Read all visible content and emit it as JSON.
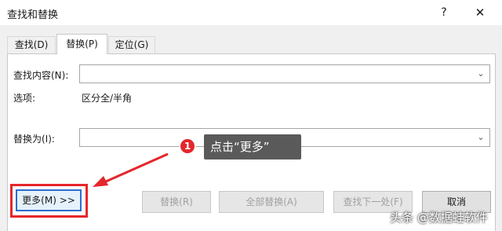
{
  "window": {
    "title": "查找和替换",
    "help_glyph": "?",
    "close_glyph": "✕"
  },
  "tabs": [
    {
      "label": "查找(D)",
      "active": false
    },
    {
      "label": "替换(P)",
      "active": true
    },
    {
      "label": "定位(G)",
      "active": false
    }
  ],
  "find": {
    "label": "查找内容(N):",
    "value": "",
    "dropdown_icon": "chevron-down-icon"
  },
  "options": {
    "label": "选项:",
    "value": "区分全/半角"
  },
  "replace": {
    "label": "替换为(I):",
    "value": "",
    "dropdown_icon": "chevron-down-icon"
  },
  "buttons": {
    "more": "更多(M) >>",
    "replace": "替换(R)",
    "replace_all": "全部替换(A)",
    "find_next": "查找下一处(F)",
    "cancel": "取消"
  },
  "annotation": {
    "badge_number": "1",
    "callout_text": "点击“更多”",
    "accent_color": "#e5262b"
  },
  "watermark": "头条 @数据蛙软件"
}
